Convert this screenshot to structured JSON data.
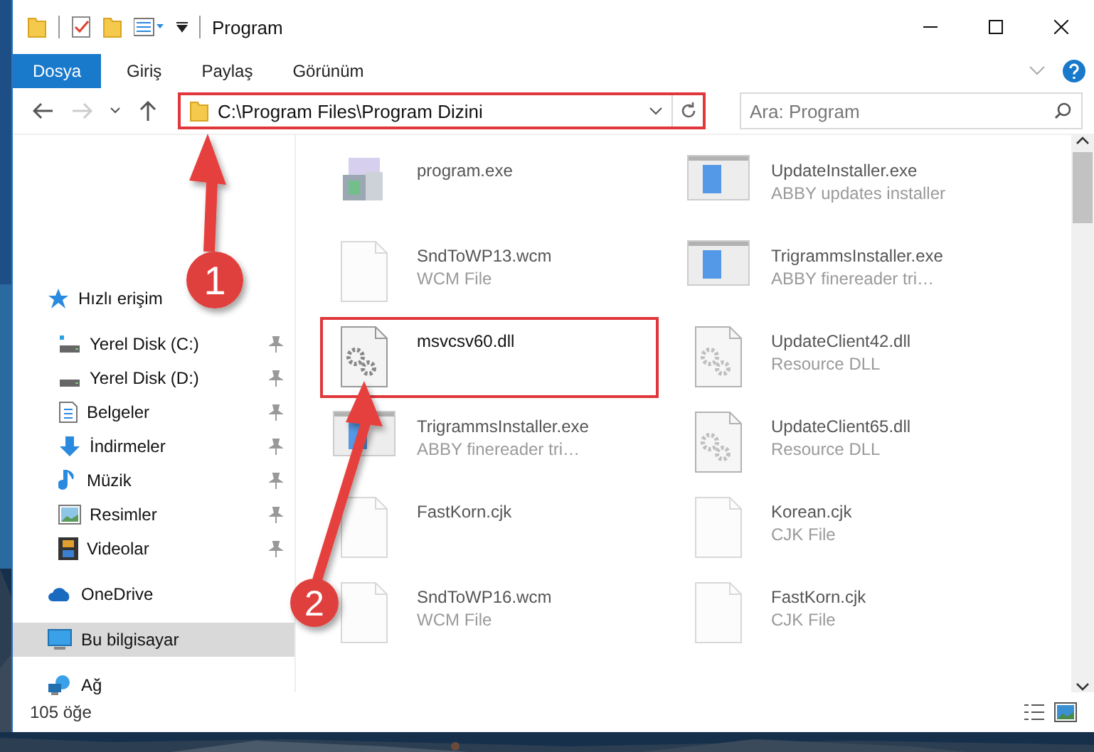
{
  "window": {
    "title": "Program"
  },
  "ribbon": {
    "tabs": [
      {
        "label": "Dosya",
        "kind": "file"
      },
      {
        "label": "Giriş",
        "kind": "tab"
      },
      {
        "label": "Paylaş",
        "kind": "tab"
      },
      {
        "label": "Görünüm",
        "kind": "tab"
      }
    ]
  },
  "address_bar": {
    "path": "C:\\Program Files\\Program Dizini",
    "framed": true
  },
  "search": {
    "placeholder": "Ara: Program"
  },
  "sidebar": {
    "items": [
      {
        "label": "Hızlı erişim",
        "selected": false,
        "children": [
          {
            "label": "Yerel Disk (C:)",
            "pinned": true,
            "selected": false
          },
          {
            "label": "Yerel Disk (D:)",
            "pinned": true,
            "selected": false
          },
          {
            "label": "Belgeler",
            "pinned": true,
            "selected": false
          },
          {
            "label": "İndirmeler",
            "pinned": true,
            "selected": false
          },
          {
            "label": "Müzik",
            "pinned": true,
            "selected": false
          },
          {
            "label": "Resimler",
            "pinned": true,
            "selected": false
          },
          {
            "label": "Videolar",
            "pinned": true,
            "selected": false
          }
        ]
      },
      {
        "label": "OneDrive",
        "selected": false
      },
      {
        "label": "Bu bilgisayar",
        "selected": true
      },
      {
        "label": "Ağ",
        "selected": false
      }
    ]
  },
  "files": [
    {
      "name": "program.exe",
      "kind": "program",
      "blurred": true,
      "framed": false
    },
    {
      "name": "UpdateInstaller.exe",
      "type": "ABBY updates installer",
      "kind": "installer",
      "blurred": true,
      "framed": false
    },
    {
      "name": "SndToWP13.wcm",
      "type": "WCM File",
      "kind": "document",
      "blurred": true,
      "framed": false
    },
    {
      "name": "TrigrammsInstaller.exe",
      "type": "ABBY finereader tri…",
      "kind": "installer",
      "blurred": true,
      "framed": false
    },
    {
      "name": "msvcsv60.dll",
      "kind": "settings",
      "blurred": false,
      "framed": true
    },
    {
      "name": "UpdateClient42.dll",
      "type": "Resource DLL",
      "kind": "library",
      "blurred": true,
      "framed": false
    },
    {
      "name": "TrigrammsInstaller.exe",
      "type": "ABBY finereader tri…",
      "kind": "installer",
      "blurred": true,
      "framed": false
    },
    {
      "name": "UpdateClient65.dll",
      "type": "Resource DLL",
      "kind": "library",
      "blurred": true,
      "framed": false
    },
    {
      "name": "FastKorn.cjk",
      "kind": "document",
      "blurred": true,
      "framed": false
    },
    {
      "name": "Korean.cjk",
      "type": "CJK File",
      "kind": "document",
      "blurred": true,
      "framed": false
    },
    {
      "name": "SndToWP16.wcm",
      "type": "WCM File",
      "kind": "document",
      "blurred": true,
      "framed": false
    },
    {
      "name": "FastKorn.cjk",
      "type": "CJK File",
      "kind": "document",
      "blurred": true,
      "framed": false
    }
  ],
  "status_bar": {
    "count": "105 öğe"
  },
  "steps": [
    {
      "number": "1"
    },
    {
      "number": "2"
    }
  ]
}
